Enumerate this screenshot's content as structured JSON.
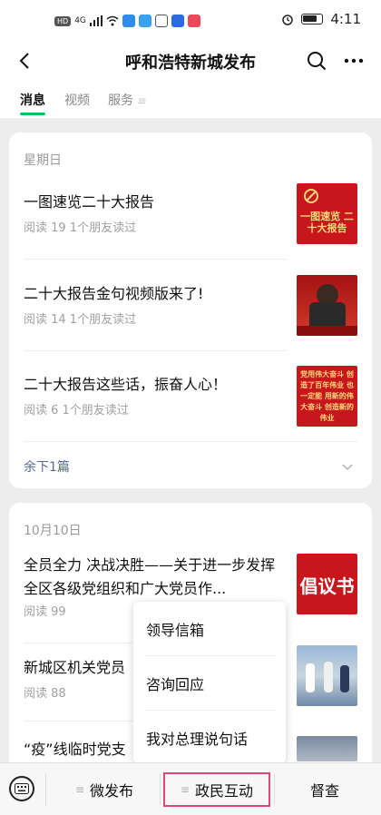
{
  "status_bar": {
    "hd_label": "HD",
    "signal_label": "4G",
    "time": "4:11"
  },
  "header": {
    "title": "呼和浩特新城发布"
  },
  "tabs": [
    {
      "label": "消息",
      "active": true
    },
    {
      "label": "视频",
      "active": false
    },
    {
      "label": "服务",
      "active": false
    }
  ],
  "cards": [
    {
      "day": "星期日",
      "articles": [
        {
          "title": "一图速览二十大报告",
          "meta": "阅读 19   1个朋友读过",
          "thumb": "一图速览 二十大报告"
        },
        {
          "title": "二十大报告金句视频版来了!",
          "meta": "阅读 14   1个朋友读过",
          "thumb": ""
        },
        {
          "title": "二十大报告这些话，振奋人心！",
          "meta": "阅读 6   1个朋友读过",
          "thumb": "党用伟大奋斗 创造了百年伟业 也一定能 用新的伟大奋斗 创造新的伟业"
        }
      ],
      "remaining": "余下1篇"
    },
    {
      "day": "10月10日",
      "articles": [
        {
          "title": "全员全力 决战决胜——关于进一步发挥全区各级党组织和广大党员作...",
          "meta": "阅读 99",
          "thumb": "倡议书"
        },
        {
          "title": "新城区机关党员",
          "meta": "阅读 88",
          "thumb": ""
        },
        {
          "title": "“疫”线临时党支",
          "meta": "",
          "thumb": ""
        }
      ]
    }
  ],
  "popup_menu": {
    "items": [
      "领导信箱",
      "咨询回应",
      "我对总理说句话"
    ]
  },
  "bottom_menu": {
    "items": [
      "微发布",
      "政民互动",
      "督查"
    ],
    "highlighted_index": 1
  },
  "colors": {
    "accent_green": "#07c160",
    "link_blue": "#576b95",
    "thumb_red": "#c8161d",
    "highlight_border": "#e0457b"
  }
}
